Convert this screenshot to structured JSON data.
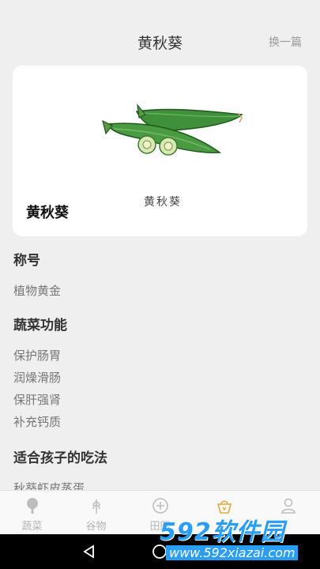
{
  "header": {
    "title": "黄秋葵",
    "switch_label": "换一篇"
  },
  "card": {
    "name": "黄秋葵",
    "caption": "黄秋葵"
  },
  "sections": [
    {
      "title": "称号",
      "items": [
        "植物黄金"
      ]
    },
    {
      "title": "蔬菜功能",
      "items": [
        "保护肠胃",
        "润燥滑肠",
        "保肝强肾",
        "补充钙质"
      ]
    },
    {
      "title": "适合孩子的吃法",
      "items": [
        "秋葵虾皮蒸蛋"
      ]
    }
  ],
  "tabs": [
    {
      "label": "蔬菜",
      "icon": "tree-icon"
    },
    {
      "label": "谷物",
      "icon": "wheat-icon"
    },
    {
      "label": "田园",
      "icon": "plus-circle-icon"
    },
    {
      "label": "",
      "icon": "basket-icon",
      "active": true
    },
    {
      "label": "",
      "icon": "person-icon"
    }
  ],
  "navbar": {
    "icons": [
      "back-icon",
      "home-icon",
      "recents-icon"
    ]
  },
  "watermark": {
    "brand": "592软件园",
    "url": "www.592xiazai.com"
  },
  "colors": {
    "accent": "#e2a93b",
    "okra_green": "#3c8d3a",
    "watermark_blue": "#2a9df4"
  }
}
